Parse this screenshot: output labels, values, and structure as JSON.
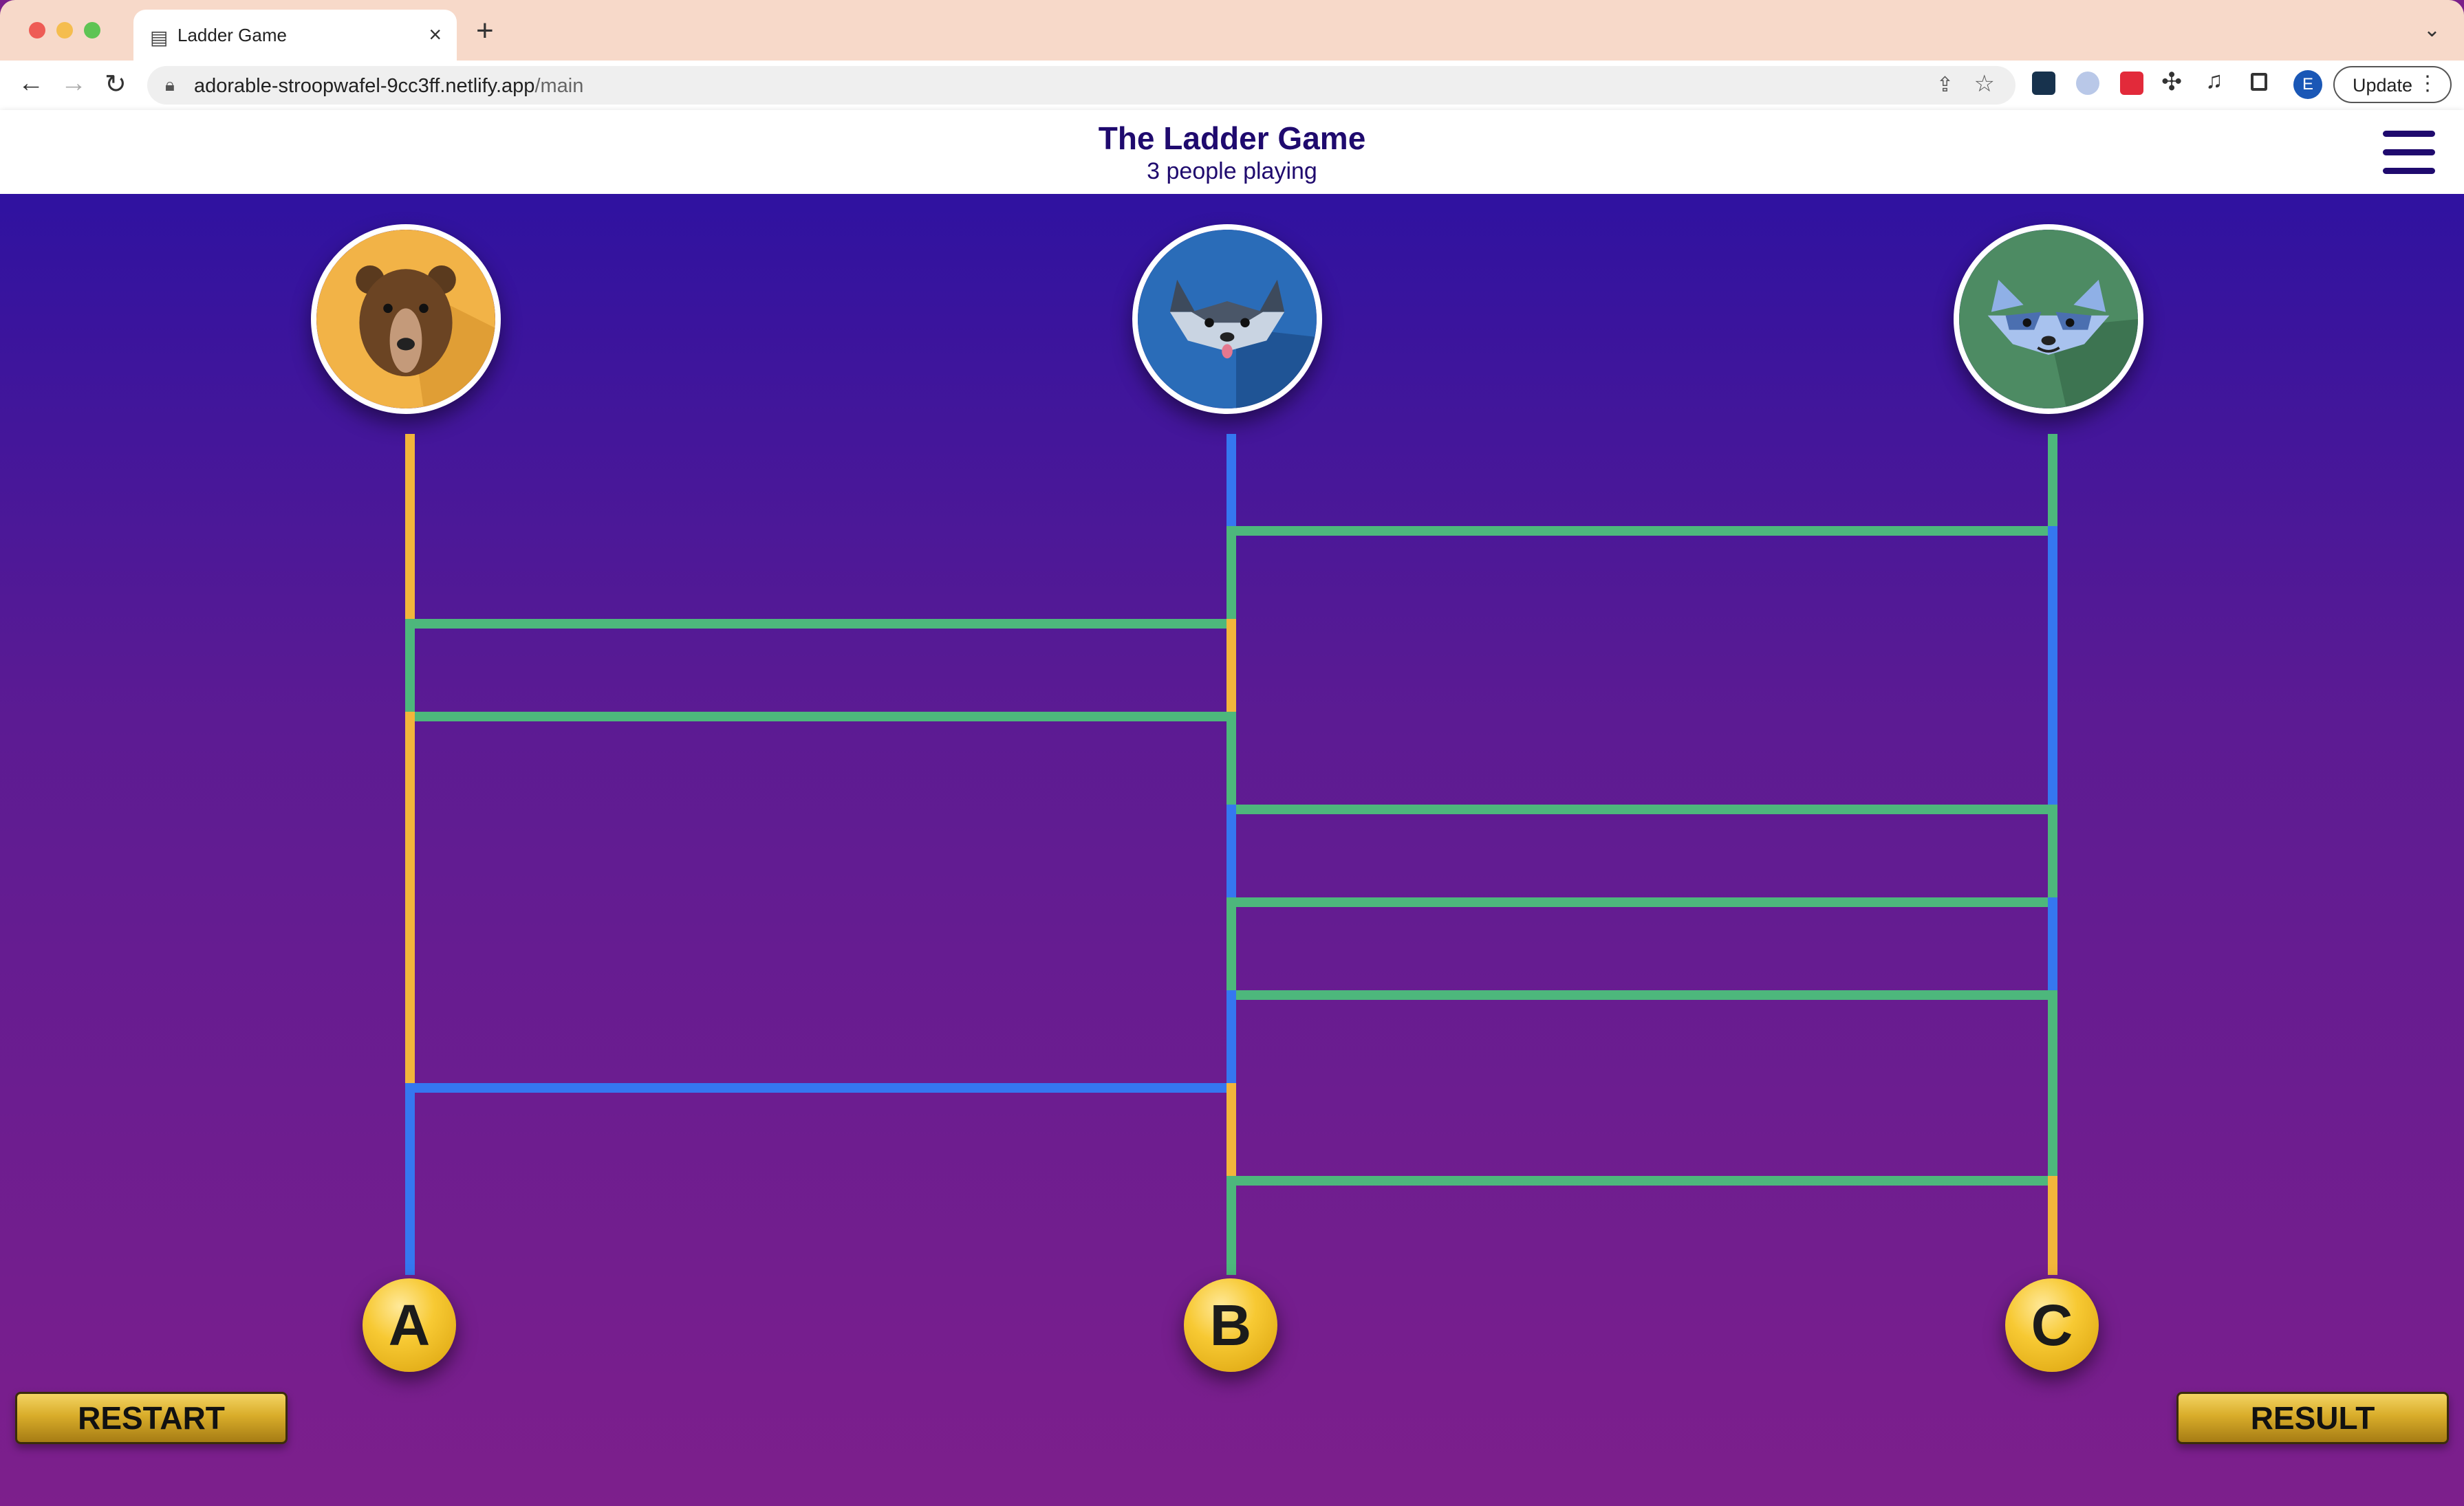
{
  "browser": {
    "tab_title": "Ladder Game",
    "tab_icon": "document-icon",
    "url_host": "adorable-stroopwafel-9cc3ff.netlify.app",
    "url_path": "/main",
    "profile_initial": "E",
    "update_label": "Update"
  },
  "header": {
    "title": "The Ladder Game",
    "subtitle": "3 people playing"
  },
  "players": [
    {
      "animal": "bear",
      "color": "#f2b347"
    },
    {
      "animal": "husky",
      "color": "#2a6cb8"
    },
    {
      "animal": "raccoon",
      "color": "#4d8b63"
    }
  ],
  "results": [
    "A",
    "B",
    "C"
  ],
  "buttons": {
    "restart": "RESTART",
    "result": "RESULT"
  },
  "colors": {
    "path_orange": "#f2b53b",
    "path_blue": "#3577f0",
    "path_green": "#4db77c",
    "header_text": "#1f0a6e"
  },
  "ladder": {
    "rungs": [
      {
        "between": [
          2,
          3
        ],
        "level": 1
      },
      {
        "between": [
          1,
          2
        ],
        "level": 2
      },
      {
        "between": [
          1,
          2
        ],
        "level": 3
      },
      {
        "between": [
          2,
          3
        ],
        "level": 4
      },
      {
        "between": [
          2,
          3
        ],
        "level": 5
      },
      {
        "between": [
          2,
          3
        ],
        "level": 6
      },
      {
        "between": [
          1,
          2
        ],
        "level": 7
      },
      {
        "between": [
          2,
          3
        ],
        "level": 8
      }
    ]
  }
}
